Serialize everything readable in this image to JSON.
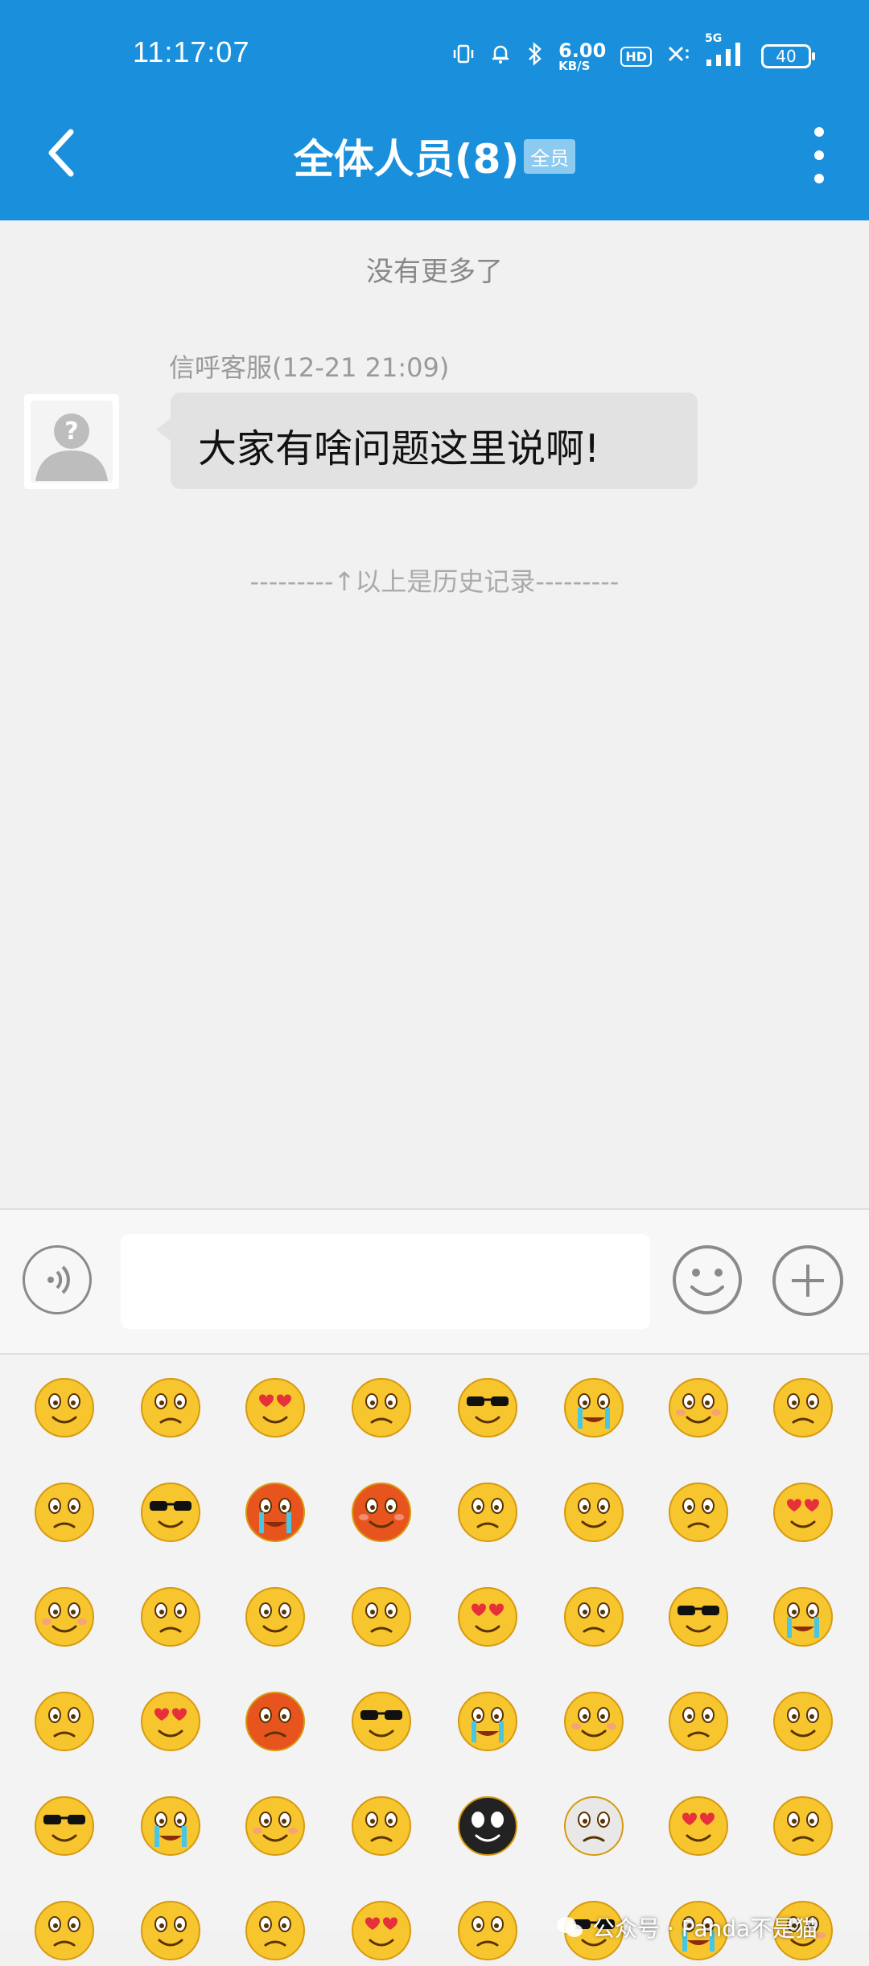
{
  "status_bar": {
    "time": "11:17:07",
    "net_speed_value": "6.00",
    "net_speed_unit": "KB/S",
    "hd_label": "HD",
    "signal_label": "5G",
    "battery": "40"
  },
  "header": {
    "title": "全体人员(8)",
    "badge": "全员",
    "background": "#1a8fdb"
  },
  "chat": {
    "no_more_text": "没有更多了",
    "messages": [
      {
        "sender_line": "信呼客服(12-21 21:09)",
        "text": "大家有啥问题这里说啊!"
      }
    ],
    "history_divider": "---------↑以上是历史记录---------"
  },
  "input_bar": {
    "text_value": "",
    "voice_icon": "voice-icon",
    "emoji_icon": "smiley-icon",
    "plus_icon": "plus-icon"
  },
  "emoji_panel": {
    "rows": 6,
    "columns": 8
  },
  "watermark": {
    "text": "公众号 · Panda不是猫"
  }
}
